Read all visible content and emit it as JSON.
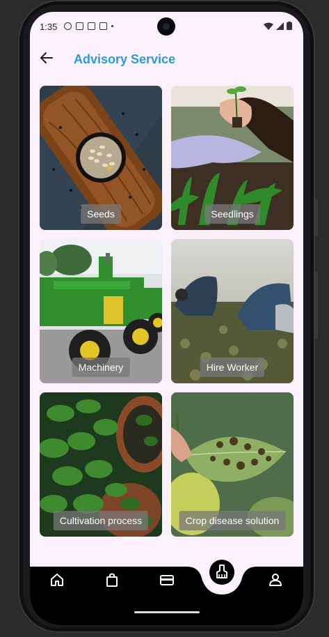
{
  "status_bar": {
    "time": "1:35"
  },
  "app_bar": {
    "title": "Advisory Service"
  },
  "services": [
    {
      "label": "Seeds",
      "image": "seeds-photo"
    },
    {
      "label": "Seedlings",
      "image": "seedlings-photo"
    },
    {
      "label": "Machinery",
      "image": "tractor-photo"
    },
    {
      "label": "Hire Worker",
      "image": "field-workers-photo"
    },
    {
      "label": "Cultivation process",
      "image": "potted-herbs-photo"
    },
    {
      "label": "Crop disease solution",
      "image": "diseased-leaf-photo"
    }
  ],
  "bottom_nav": {
    "items": [
      {
        "icon": "home-icon"
      },
      {
        "icon": "shopping-bag-icon"
      },
      {
        "icon": "wallet-icon"
      },
      {
        "icon": "broom-icon",
        "selected": true
      },
      {
        "icon": "person-icon"
      }
    ]
  },
  "colors": {
    "accent": "#2a9be0",
    "background": "#fbf1fb",
    "nav": "#000000"
  }
}
